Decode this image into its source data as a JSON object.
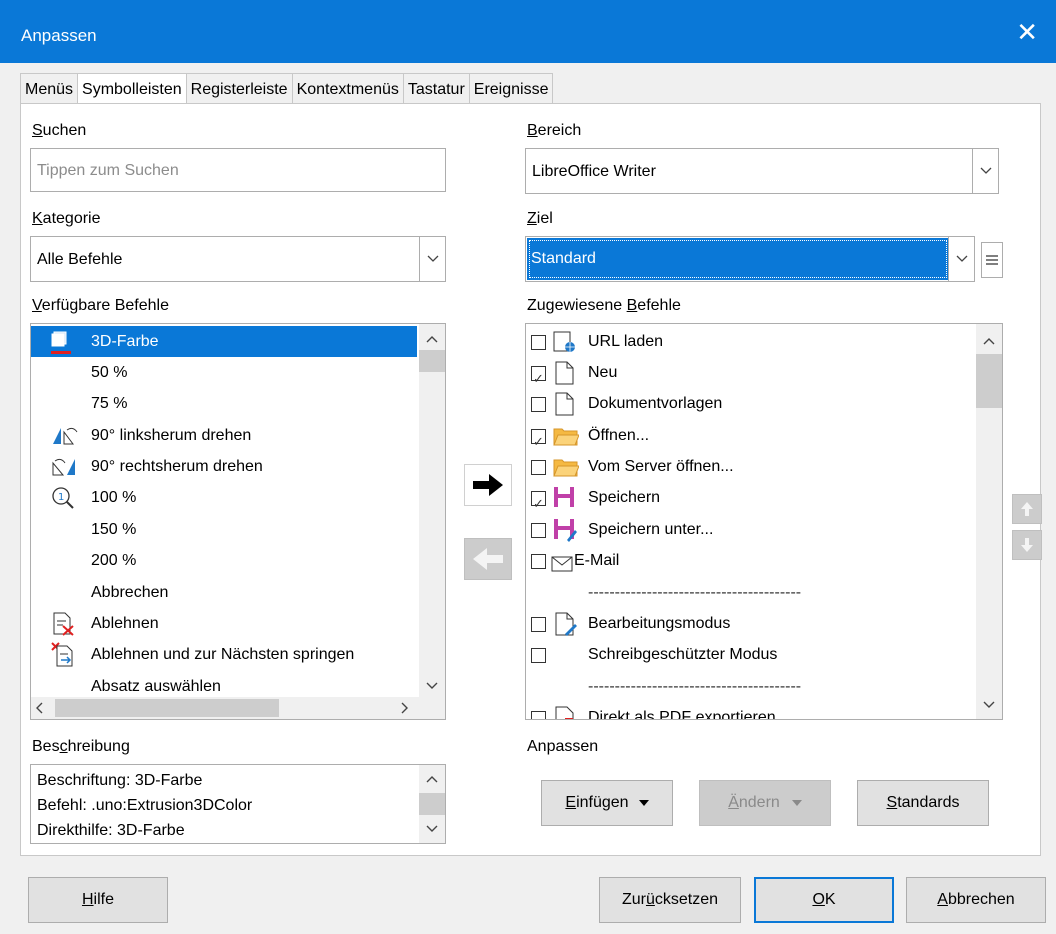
{
  "window": {
    "title": "Anpassen",
    "close": "✕"
  },
  "tabs": [
    {
      "label": "Menüs"
    },
    {
      "label": "Symbolleisten"
    },
    {
      "label": "Registerleiste"
    },
    {
      "label": "Kontextmenüs"
    },
    {
      "label": "Tastatur"
    },
    {
      "label": "Ereignisse"
    }
  ],
  "left": {
    "search_label_u": "S",
    "search_label_rest": "uchen",
    "search_placeholder": "Tippen zum Suchen",
    "category_label_u": "K",
    "category_label_rest": "ategorie",
    "category_value": "Alle Befehle",
    "available_label_u": "V",
    "available_label_rest": "erfügbare Befehle",
    "commands": [
      {
        "label": "3D-Farbe",
        "icon": "3d-color-icon"
      },
      {
        "label": "50 %",
        "icon": ""
      },
      {
        "label": "75 %",
        "icon": ""
      },
      {
        "label": "90° linksherum drehen",
        "icon": "rotate-left-icon"
      },
      {
        "label": "90° rechtsherum drehen",
        "icon": "rotate-right-icon"
      },
      {
        "label": "100 %",
        "icon": "zoom-100-icon"
      },
      {
        "label": "150 %",
        "icon": ""
      },
      {
        "label": "200 %",
        "icon": ""
      },
      {
        "label": "Abbrechen",
        "icon": ""
      },
      {
        "label": "Ablehnen",
        "icon": "reject-icon"
      },
      {
        "label": "Ablehnen und zur Nächsten springen",
        "icon": "reject-next-icon"
      },
      {
        "label": "Absatz auswählen",
        "icon": ""
      }
    ],
    "desc_label_pre": "Bes",
    "desc_label_u": "c",
    "desc_label_rest": "hreibung",
    "description": [
      "Beschriftung: 3D-Farbe",
      "Befehl: .uno:Extrusion3DColor",
      "Direkthilfe: 3D-Farbe"
    ]
  },
  "right": {
    "scope_label_u": "B",
    "scope_label_rest": "ereich",
    "scope_value": "LibreOffice Writer",
    "target_label_u": "Z",
    "target_label_rest": "iel",
    "target_value": "Standard",
    "assigned_label_pre": "Zugewiesene ",
    "assigned_label_u": "B",
    "assigned_label_rest": "efehle",
    "assigned": [
      {
        "label": "URL laden",
        "checked": false,
        "icon": "url-load-icon"
      },
      {
        "label": "Neu",
        "checked": true,
        "icon": "new-document-icon"
      },
      {
        "label": "Dokumentvorlagen",
        "checked": false,
        "icon": "templates-icon"
      },
      {
        "label": "Öffnen...",
        "checked": true,
        "icon": "folder-open-icon"
      },
      {
        "label": "Vom Server öffnen...",
        "checked": false,
        "icon": "folder-server-icon"
      },
      {
        "label": "Speichern",
        "checked": true,
        "icon": "save-icon"
      },
      {
        "label": "Speichern unter...",
        "checked": false,
        "icon": "save-as-icon"
      },
      {
        "label": "E-Mail",
        "checked": false,
        "icon": "mail-icon"
      },
      {
        "label": "----------------------------------------",
        "separator": true
      },
      {
        "label": "Bearbeitungsmodus",
        "checked": false,
        "icon": "edit-mode-icon"
      },
      {
        "label": "Schreibgeschützter Modus",
        "checked": false,
        "icon": ""
      },
      {
        "label": "----------------------------------------",
        "separator": true
      },
      {
        "label": "Direkt als PDF exportieren",
        "checked": true,
        "icon": "pdf-icon"
      }
    ],
    "customize_label": "Anpassen",
    "insert_u": "E",
    "insert_rest": "infügen",
    "modify_u": "Ä",
    "modify_rest": "ndern",
    "defaults_u": "S",
    "defaults_rest": "tandards"
  },
  "footer": {
    "help_u": "H",
    "help_rest": "ilfe",
    "reset_pre": "Zur",
    "reset_u": "ü",
    "reset_rest": "cksetzen",
    "ok_u": "O",
    "ok_rest": "K",
    "cancel_u": "A",
    "cancel_rest": "bbrechen"
  },
  "colors": {
    "accent": "#0a78d7",
    "folder": "#f5b942",
    "save": "#c040a8"
  }
}
